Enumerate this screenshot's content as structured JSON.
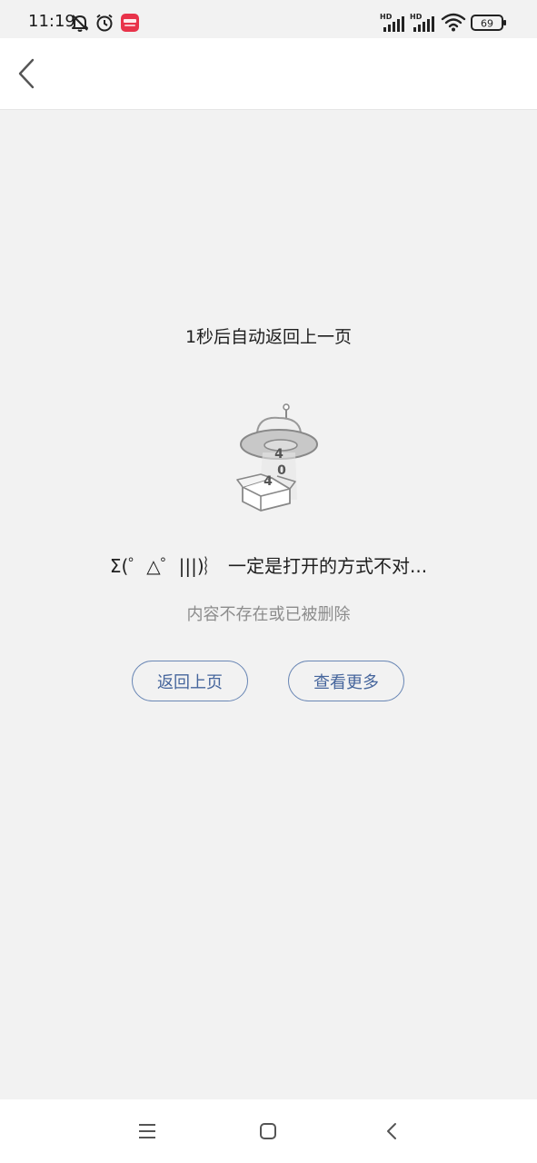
{
  "status_bar": {
    "time": "11:19",
    "battery": "69",
    "signal_label": "HD",
    "icons": [
      "bell-off-icon",
      "alarm-icon",
      "app-notification-icon",
      "signal-hd-icon",
      "wifi-icon",
      "battery-icon"
    ]
  },
  "header": {
    "back_icon": "chevron-left-icon"
  },
  "main": {
    "countdown_text": "1秒后自动返回上一页",
    "illustration_chars": [
      "4",
      "0",
      "4"
    ],
    "error_title": "Σ(゜△゜|||)︴ 一定是打开的方式不对...",
    "error_subtitle": "内容不存在或已被删除",
    "back_button_label": "返回上页",
    "more_button_label": "查看更多"
  },
  "nav_bar": {
    "icons": [
      "menu-icon",
      "home-icon",
      "back-icon"
    ]
  },
  "colors": {
    "background": "#f2f2f2",
    "header_bg": "#ffffff",
    "button_border": "#6a87b5",
    "button_text": "#45659c",
    "subtitle_text": "#8c8c8c"
  }
}
